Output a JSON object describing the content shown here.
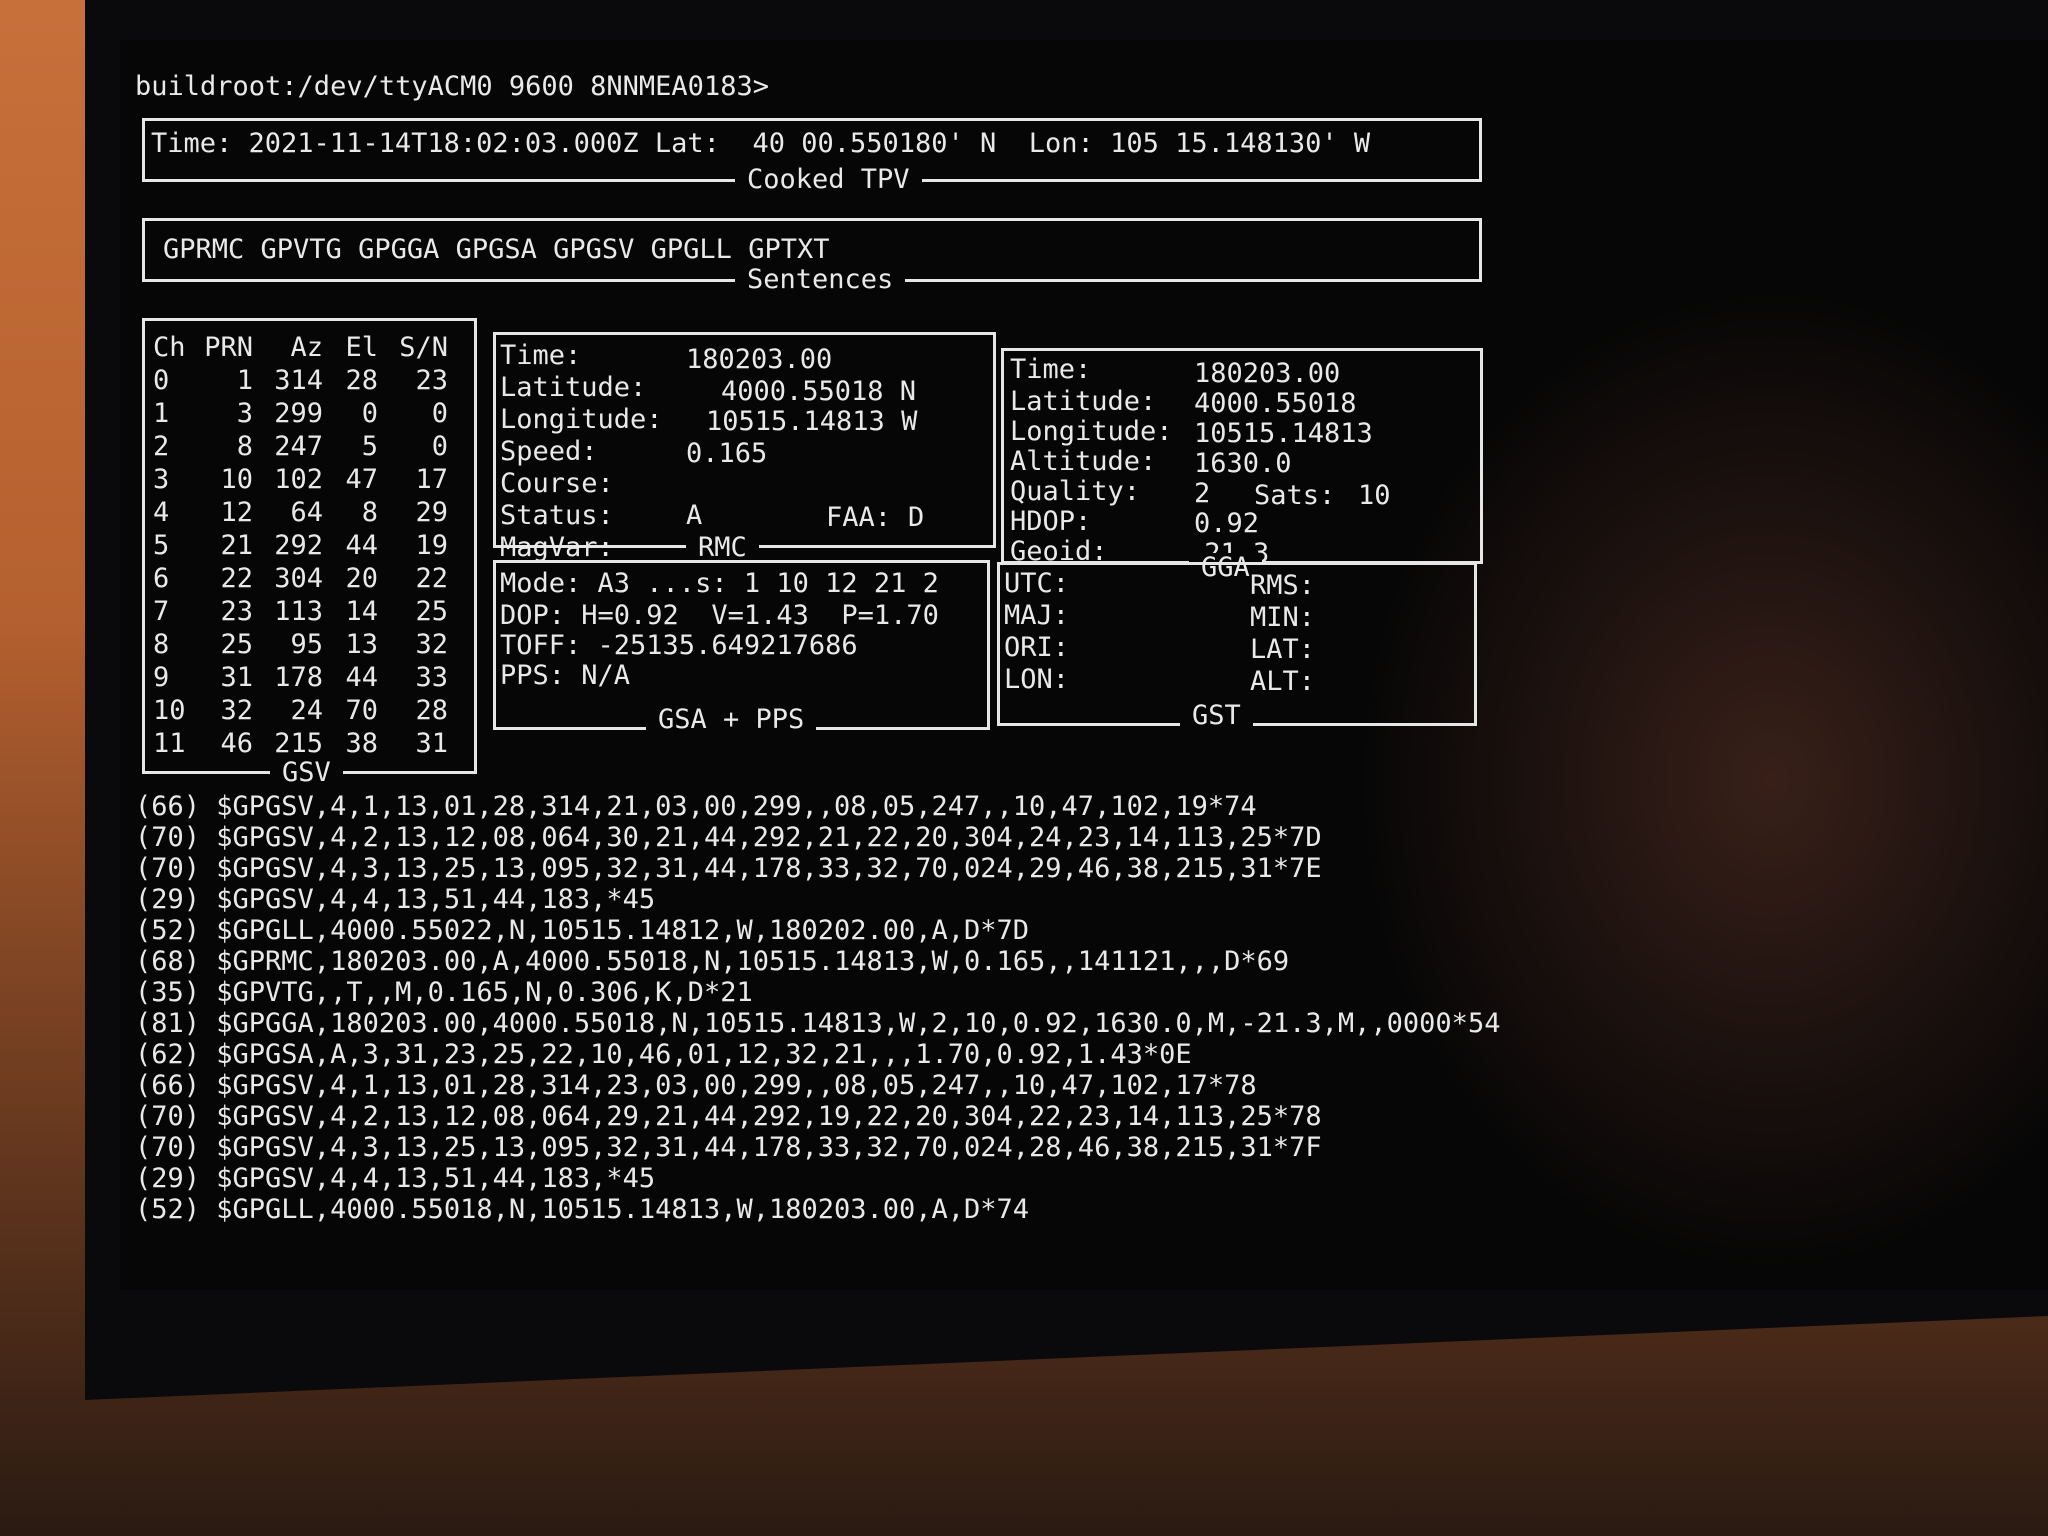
{
  "prompt": "buildroot:/dev/ttyACM0 9600 8NNMEA0183>",
  "tpv": {
    "title": "Cooked TPV",
    "line": "Time: 2021-11-14T18:02:03.000Z Lat:  40 00.550180' N  Lon: 105 15.148130' W"
  },
  "sentences": {
    "title": "Sentences",
    "line": "GPRMC GPVTG GPGGA GPGSA GPGSV GPGLL GPTXT"
  },
  "gsv": {
    "title": "GSV",
    "headers": [
      "Ch",
      "PRN",
      "Az",
      "El",
      "S/N"
    ],
    "rows": [
      [
        "0",
        "1",
        "314",
        "28",
        "23"
      ],
      [
        "1",
        "3",
        "299",
        "0",
        "0"
      ],
      [
        "2",
        "8",
        "247",
        "5",
        "0"
      ],
      [
        "3",
        "10",
        "102",
        "47",
        "17"
      ],
      [
        "4",
        "12",
        "64",
        "8",
        "29"
      ],
      [
        "5",
        "21",
        "292",
        "44",
        "19"
      ],
      [
        "6",
        "22",
        "304",
        "20",
        "22"
      ],
      [
        "7",
        "23",
        "113",
        "14",
        "25"
      ],
      [
        "8",
        "25",
        "95",
        "13",
        "32"
      ],
      [
        "9",
        "31",
        "178",
        "44",
        "33"
      ],
      [
        "10",
        "32",
        "24",
        "70",
        "28"
      ],
      [
        "11",
        "46",
        "215",
        "38",
        "31"
      ]
    ]
  },
  "rmc": {
    "title": "RMC",
    "time_label": "Time:",
    "time": "180203.00",
    "lat_label": "Latitude:",
    "lat": "4000.55018 N",
    "lon_label": "Longitude:",
    "lon": "10515.14813 W",
    "speed_label": "Speed:",
    "speed": "0.165",
    "course_label": "Course:",
    "course": "",
    "status_label": "Status:",
    "status": "A",
    "faa_label": "FAA:",
    "faa": "D",
    "magvar_label": "MagVar:",
    "magvar": ""
  },
  "gga": {
    "title": "GGA",
    "time_label": "Time:",
    "time": "180203.00",
    "lat_label": "Latitude:",
    "lat": "4000.55018",
    "lon_label": "Longitude:",
    "lon": "10515.14813",
    "alt_label": "Altitude:",
    "alt": "1630.0",
    "quality_label": "Quality:",
    "quality": "2",
    "sats_label": "Sats:",
    "sats": "10",
    "hdop_label": "HDOP:",
    "hdop": "0.92",
    "geoid_label": "Geoid:",
    "geoid": "-21.3"
  },
  "gsa": {
    "title": "GSA + PPS",
    "mode": "Mode: A3 ...s: 1 10 12 21 2",
    "dop": "DOP: H=0.92  V=1.43  P=1.70",
    "toff": "TOFF: -25135.649217686",
    "pps": "PPS: N/A"
  },
  "gst": {
    "title": "GST",
    "utc": "UTC:",
    "rms": "RMS:",
    "maj": "MAJ:",
    "min": "MIN:",
    "ori": "ORI:",
    "lat": "LAT:",
    "lon": "LON:",
    "alt": "ALT:"
  },
  "raw_lines": [
    "(66) $GPGSV,4,1,13,01,28,314,21,03,00,299,,08,05,247,,10,47,102,19*74",
    "(70) $GPGSV,4,2,13,12,08,064,30,21,44,292,21,22,20,304,24,23,14,113,25*7D",
    "(70) $GPGSV,4,3,13,25,13,095,32,31,44,178,33,32,70,024,29,46,38,215,31*7E",
    "(29) $GPGSV,4,4,13,51,44,183,*45",
    "(52) $GPGLL,4000.55022,N,10515.14812,W,180202.00,A,D*7D",
    "(68) $GPRMC,180203.00,A,4000.55018,N,10515.14813,W,0.165,,141121,,,D*69",
    "(35) $GPVTG,,T,,M,0.165,N,0.306,K,D*21",
    "(81) $GPGGA,180203.00,4000.55018,N,10515.14813,W,2,10,0.92,1630.0,M,-21.3,M,,0000*54",
    "(62) $GPGSA,A,3,31,23,25,22,10,46,01,12,32,21,,,1.70,0.92,1.43*0E",
    "(66) $GPGSV,4,1,13,01,28,314,23,03,00,299,,08,05,247,,10,47,102,17*78",
    "(70) $GPGSV,4,2,13,12,08,064,29,21,44,292,19,22,20,304,22,23,14,113,25*78",
    "(70) $GPGSV,4,3,13,25,13,095,32,31,44,178,33,32,70,024,28,46,38,215,31*7F",
    "(29) $GPGSV,4,4,13,51,44,183,*45",
    "(52) $GPGLL,4000.55018,N,10515.14813,W,180203.00,A,D*74"
  ]
}
